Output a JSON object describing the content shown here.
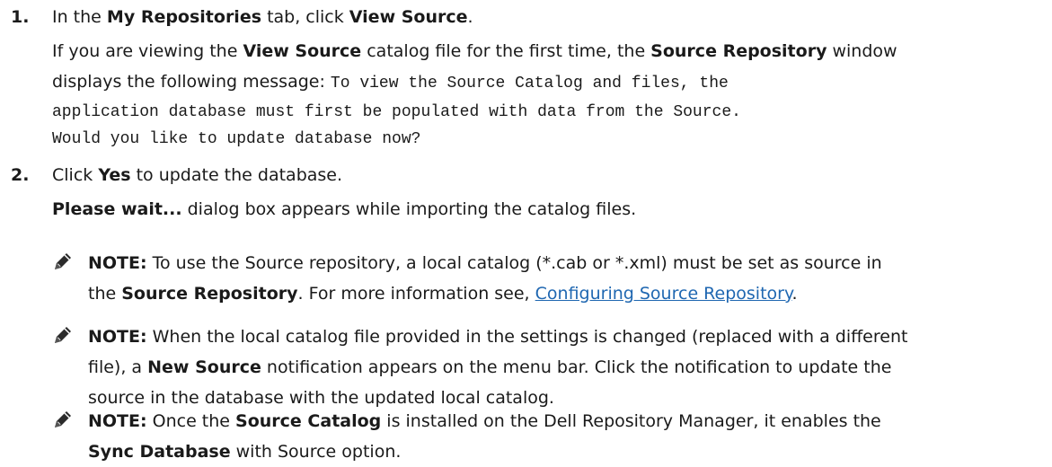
{
  "step1": {
    "number": "1.",
    "intro_pre": "In the ",
    "intro_tab": "My Repositories",
    "intro_mid": " tab, click ",
    "intro_button": "View Source",
    "intro_post": ".",
    "detail_pre": "If you are viewing the ",
    "detail_bold1": "View Source",
    "detail_mid": " catalog file for the first time, the ",
    "detail_bold2": "Source Repository",
    "detail_post": " window",
    "detail_line2_pre": "displays the following message: ",
    "message_part1": "To view the Source Catalog and files, the",
    "message_part2": "application database must first be populated with data from the Source.",
    "message_part3": "Would you like to update database now?"
  },
  "step2": {
    "number": "2.",
    "click_pre": "Click ",
    "click_bold": "Yes",
    "click_post": " to update the database.",
    "wait_bold": "Please wait...",
    "wait_post": " dialog box appears while importing the catalog files."
  },
  "notes": [
    {
      "icon": "pencil-note-icon",
      "label": "NOTE:",
      "l1": " To use the Source repository, a local catalog (*.cab or *.xml) must be set as source in",
      "l2_pre": "the ",
      "l2_bold": "Source Repository",
      "l2_mid": ". For more information see, ",
      "l2_link": "Configuring Source Repository",
      "l2_post": "."
    },
    {
      "icon": "pencil-note-icon",
      "label": "NOTE:",
      "l1": " When the local catalog file provided in the settings is changed (replaced with a different",
      "l2_pre": "file), a ",
      "l2_bold": "New Source",
      "l2_post": " notification appears on the menu bar. Click the notification to update the",
      "l3": "source in the database with the updated local catalog."
    },
    {
      "icon": "pencil-note-icon",
      "label": "NOTE:",
      "l1_pre": " Once the ",
      "l1_bold": "Source Catalog",
      "l1_post": " is installed on the Dell Repository Manager, it enables the",
      "l2_bold": "Sync Database",
      "l2_post": " with Source option."
    }
  ],
  "colors": {
    "link": "#1f67b1",
    "text": "#1a1a1a"
  }
}
